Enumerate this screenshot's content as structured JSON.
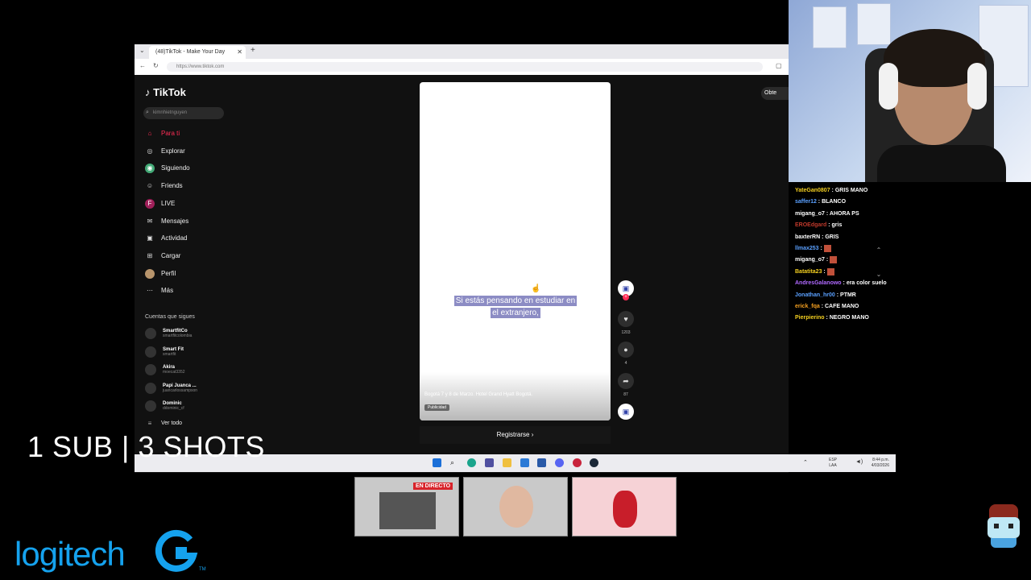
{
  "browser": {
    "tab_title": "(48)TikTok - Make Your Day",
    "url": "https://www.tiktok.com"
  },
  "tiktok": {
    "logo": "TikTok",
    "search_placeholder": "kimnhietnguyen",
    "nav": [
      {
        "label": "Para ti",
        "icon": "home-icon",
        "active": true
      },
      {
        "label": "Explorar",
        "icon": "compass-icon"
      },
      {
        "label": "Siguiendo",
        "icon": "following-icon"
      },
      {
        "label": "Friends",
        "icon": "friends-icon"
      },
      {
        "label": "LIVE",
        "icon": "live-icon"
      },
      {
        "label": "Mensajes",
        "icon": "messages-icon"
      },
      {
        "label": "Actividad",
        "icon": "activity-icon"
      },
      {
        "label": "Cargar",
        "icon": "upload-icon"
      },
      {
        "label": "Perfil",
        "icon": "profile-icon"
      },
      {
        "label": "Más",
        "icon": "more-icon"
      }
    ],
    "following_title": "Cuentas que sigues",
    "accounts": [
      {
        "name": "SmartfitCo",
        "handle": "smartfitcolombia"
      },
      {
        "name": "Smart Fit",
        "handle": "smartfit"
      },
      {
        "name": "Akira",
        "handle": "moecat3352"
      },
      {
        "name": "Papi Juanca ...",
        "handle": "juancarlossampson"
      },
      {
        "name": "Dominic",
        "handle": "ddominic_cf"
      }
    ],
    "see_all": "Ver todo",
    "video": {
      "caption_line1": "Si estás pensando en estudiar en",
      "caption_line2": "el extranjero,",
      "description": "Bogotá 7 y 8 de Marzo. Hotel Grand Hyatt Bogotá.",
      "ad_label": "Publicidad",
      "likes": "1203",
      "comments": "4",
      "shares": "87"
    },
    "register_button": "Registrarse",
    "get_app": "Obte"
  },
  "taskbar": {
    "lang_line1": "ESP",
    "lang_line2": "LAA",
    "time": "8:44 p.m.",
    "date": "4/03/2026"
  },
  "chat": [
    {
      "user": "YateGan0807",
      "text": "GRIS MANO",
      "color": "#f5d020"
    },
    {
      "user": "saffer12",
      "text": "BLANCO",
      "color": "#5aa0ff"
    },
    {
      "user": "migang_o7",
      "text": "AHORA PS",
      "color": "#ffffff"
    },
    {
      "user": "EROEdgard",
      "text": "gris",
      "color": "#c0392b"
    },
    {
      "user": "baxterRN",
      "text": "GRIS",
      "color": "#ffffff"
    },
    {
      "user": "llmax253",
      "text": "",
      "color": "#5aa0ff"
    },
    {
      "user": "migang_o7",
      "text": "",
      "color": "#ffffff"
    },
    {
      "user": "Batatita23",
      "text": "",
      "color": "#f5d020"
    },
    {
      "user": "AndresGalanowo",
      "text": "era color suelo",
      "color": "#b069ff"
    },
    {
      "user": "Jonathan_hr00",
      "text": "PTMR",
      "color": "#5aa0ff"
    },
    {
      "user": "erick_fqa",
      "text": "CAFE MANO",
      "color": "#f5a020"
    },
    {
      "user": "Pierpierino",
      "text": "NEGRO MANO",
      "color": "#f5d020"
    }
  ],
  "overlay": {
    "sub_shots": "1 SUB | 3 SHOTS",
    "sponsor": "logitech",
    "tm": "TM",
    "live_badge": "EN DIRECTO"
  }
}
